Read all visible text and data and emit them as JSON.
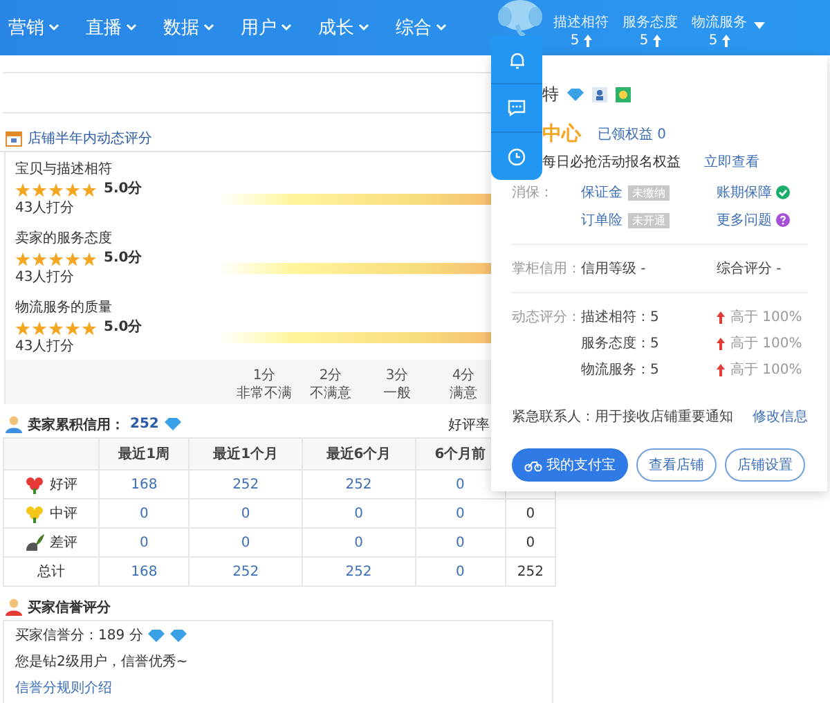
{
  "nav": [
    {
      "label": "营销"
    },
    {
      "label": "直播"
    },
    {
      "label": "数据"
    },
    {
      "label": "用户"
    },
    {
      "label": "成长"
    },
    {
      "label": "综合"
    }
  ],
  "header_stats": [
    {
      "label": "描述相符",
      "value": "5"
    },
    {
      "label": "服务态度",
      "value": "5"
    },
    {
      "label": "物流服务",
      "value": "5"
    }
  ],
  "rating": {
    "title": "店铺半年内动态评分",
    "items": [
      {
        "label": "宝贝与描述相符",
        "stars": 5,
        "score": "5.0分",
        "count": "43人打分"
      },
      {
        "label": "卖家的服务态度",
        "stars": 5,
        "score": "5.0分",
        "count": "43人打分"
      },
      {
        "label": "物流服务的质量",
        "stars": 5,
        "score": "5.0分",
        "count": "43人打分"
      }
    ],
    "axis": [
      {
        "score": "1分",
        "desc": "非常不满"
      },
      {
        "score": "2分",
        "desc": "不满意"
      },
      {
        "score": "3分",
        "desc": "一般"
      },
      {
        "score": "4分",
        "desc": "满意"
      }
    ]
  },
  "seller_credit": {
    "label": "卖家累积信用：",
    "score": "252",
    "good_rate_label": "好评率",
    "columns": [
      "最近1周",
      "最近1个月",
      "最近6个月",
      "6个月前"
    ],
    "rows": [
      {
        "kind": "good",
        "label": "好评",
        "cells": [
          "168",
          "252",
          "252",
          "0"
        ]
      },
      {
        "kind": "neutral",
        "label": "中评",
        "cells": [
          "0",
          "0",
          "0",
          "0",
          "0"
        ]
      },
      {
        "kind": "bad",
        "label": "差评",
        "cells": [
          "0",
          "0",
          "0",
          "0",
          "0"
        ]
      },
      {
        "kind": "total",
        "label": "总计",
        "cells": [
          "168",
          "252",
          "252",
          "0",
          "252"
        ]
      }
    ]
  },
  "buyer_credit": {
    "title": "买家信誉评分",
    "score": "买家信誉分：189 分",
    "message": "您是钻2级用户，信誉优秀~",
    "link": "信誉分规则介绍"
  },
  "popup": {
    "shop_name": "特",
    "center_title": "中心",
    "claimed": "已领权益 0",
    "promo": "每日必抢活动报名权益",
    "promo_link": "立即查看",
    "protection": {
      "label": "消保：",
      "items": [
        {
          "kind": "tag",
          "text": "保证金",
          "tag": "未缴纳"
        },
        {
          "kind": "check",
          "text": "账期保障"
        },
        {
          "kind": "tag",
          "text": "订单险",
          "tag": "未开通"
        },
        {
          "kind": "help",
          "text": "更多问题"
        }
      ]
    },
    "credit": {
      "label": "掌柜信用：",
      "level": "信用等级 -",
      "overall": "综合评分 -"
    },
    "dynamic": {
      "label": "动态评分：",
      "rows": [
        {
          "name": "描述相符：5",
          "compare": "高于 100%"
        },
        {
          "name": "服务态度：5",
          "compare": "高于 100%"
        },
        {
          "name": "物流服务：5",
          "compare": "高于 100%"
        }
      ]
    },
    "contact": {
      "label": "紧急联系人：用于接收店铺重要通知",
      "link": "修改信息"
    },
    "buttons": [
      {
        "kind": "primary",
        "label": "我的支付宝"
      },
      {
        "kind": "outline",
        "label": "查看店铺"
      },
      {
        "kind": "outline",
        "label": "店铺设置"
      }
    ]
  }
}
